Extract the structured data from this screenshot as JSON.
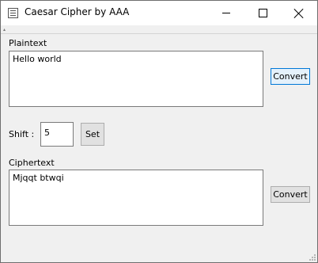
{
  "window": {
    "title": "Caesar Cipher by AAA"
  },
  "icons": {
    "app": "app-window-icon",
    "minimize": "minimize-icon",
    "maximize": "maximize-icon",
    "close": "close-icon"
  },
  "plaintext": {
    "label": "Plaintext",
    "value": "Hello world",
    "convert_label": "Convert"
  },
  "shift": {
    "label": "Shift :",
    "value": "5",
    "set_label": "Set"
  },
  "ciphertext": {
    "label": "Ciphertext",
    "value": "Mjqqt btwqi",
    "convert_label": "Convert"
  },
  "colors": {
    "window_bg": "#f0f0f0",
    "focus_accent": "#0078d7"
  }
}
